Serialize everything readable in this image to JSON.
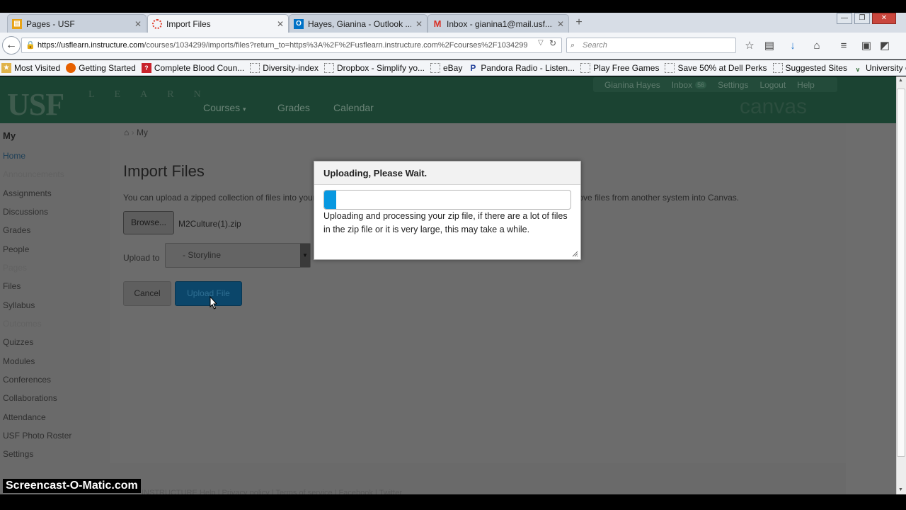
{
  "browser": {
    "tabs": [
      {
        "title": "Pages - USF",
        "icon": "pages-favicon",
        "color": "#e8a317"
      },
      {
        "title": "Import Files",
        "icon": "canvas-favicon",
        "color": "#e03e2d",
        "active": true
      },
      {
        "title": "Hayes, Gianina - Outlook ...",
        "icon": "outlook-favicon",
        "color": "#0072c6"
      },
      {
        "title": "Inbox - gianina1@mail.usf....",
        "icon": "gmail-favicon",
        "color": "#d93025"
      }
    ],
    "new_tab": "+",
    "url_host": "https://usflearn.instructure.com",
    "url_path": "/courses/1034299/imports/files?return_to=https%3A%2F%2Fusflearn.instructure.com%2Fcourses%2F1034299",
    "search_placeholder": "Search",
    "bookmarks": [
      {
        "label": "Most Visited",
        "icon": "star-folder-icon"
      },
      {
        "label": "Getting Started",
        "icon": "firefox-icon"
      },
      {
        "label": "Complete Blood Coun...",
        "icon": "bookmark-page-icon"
      },
      {
        "label": "Diversity-index",
        "icon": "blank-page-icon"
      },
      {
        "label": "Dropbox - Simplify yo...",
        "icon": "blank-page-icon"
      },
      {
        "label": "eBay",
        "icon": "blank-page-icon"
      },
      {
        "label": "Pandora Radio - Listen...",
        "icon": "pandora-icon"
      },
      {
        "label": "Play Free Games",
        "icon": "blank-page-icon"
      },
      {
        "label": "Save 50% at Dell Perks",
        "icon": "blank-page-icon"
      },
      {
        "label": "Suggested Sites",
        "icon": "blank-page-icon"
      },
      {
        "label": "University of South Flo...",
        "icon": "usf-bull-icon"
      }
    ]
  },
  "canvas": {
    "logo": "USF",
    "logo_sub": "LEARN",
    "nav": {
      "courses": "Courses",
      "grades": "Grades",
      "calendar": "Calendar"
    },
    "user": {
      "name": "Gianina Hayes",
      "inbox": "Inbox",
      "inbox_count": "56",
      "settings": "Settings",
      "logout": "Logout",
      "help": "Help"
    },
    "brand": "canvas",
    "left_nav_title": "My",
    "left_nav": [
      {
        "label": "Home",
        "style": "home"
      },
      {
        "label": "Announcements",
        "style": "dim"
      },
      {
        "label": "Assignments",
        "style": "normal"
      },
      {
        "label": "Discussions",
        "style": "normal"
      },
      {
        "label": "Grades",
        "style": "normal"
      },
      {
        "label": "People",
        "style": "normal"
      },
      {
        "label": "Pages",
        "style": "dim"
      },
      {
        "label": "Files",
        "style": "normal"
      },
      {
        "label": "Syllabus",
        "style": "normal"
      },
      {
        "label": "Outcomes",
        "style": "dim"
      },
      {
        "label": "Quizzes",
        "style": "normal"
      },
      {
        "label": "Modules",
        "style": "normal"
      },
      {
        "label": "Conferences",
        "style": "normal"
      },
      {
        "label": "Collaborations",
        "style": "normal"
      },
      {
        "label": "Attendance",
        "style": "normal"
      },
      {
        "label": "USF Photo Roster",
        "style": "normal"
      },
      {
        "label": "Settings",
        "style": "normal"
      }
    ],
    "breadcrumb": "My",
    "page_title": "Import Files",
    "description": "You can upload a zipped collection of files into your course and we'll extract them all out for you. This is an easy way to move files from another system into Canvas.",
    "browse_label": "Browse...",
    "file_name": "M2Culture(1).zip",
    "upload_to_label": "Upload to",
    "folder_value": "- Storyline",
    "cancel_label": "Cancel",
    "upload_label": "Upload File",
    "footer": "INSTRUCTURE    Help  |  Privacy policy  |  Terms of service  |  Facebook  |  Twitter"
  },
  "dialog": {
    "title": "Uploading, Please Wait.",
    "progress": 0.05,
    "message": "Uploading and processing your zip file, if there are a lot of files in the zip file or it is very large, this may take a while."
  },
  "watermark": "Screencast-O-Matic.com"
}
